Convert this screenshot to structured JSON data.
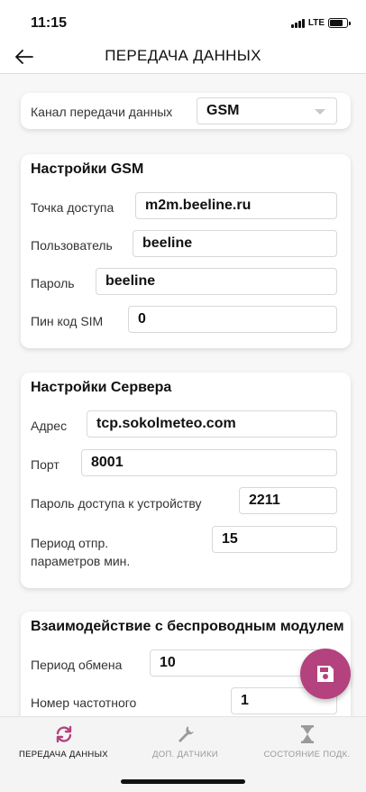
{
  "status_bar": {
    "time": "11:15",
    "network": "LTE"
  },
  "header": {
    "title": "ПЕРЕДАЧА ДАННЫХ"
  },
  "channel": {
    "label": "Канал передачи данных",
    "value": "GSM"
  },
  "gsm": {
    "title": "Настройки GSM",
    "apn_label": "Точка доступа",
    "apn_value": "m2m.beeline.ru",
    "user_label": "Пользователь",
    "user_value": "beeline",
    "password_label": "Пароль",
    "password_value": "beeline",
    "pin_label": "Пин код SIM",
    "pin_value": "0"
  },
  "server": {
    "title": "Настройки Сервера",
    "address_label": "Адрес",
    "address_value": "tcp.sokolmeteo.com",
    "port_label": "Порт",
    "port_value": "8001",
    "device_password_label": "Пароль доступа к устройству",
    "device_password_value": "2211",
    "period_label_line1": "Период отпр.",
    "period_label_line2": "параметров мин.",
    "period_value": "15"
  },
  "wireless": {
    "title": "Взаимодействие с беспроводным модулем",
    "exchange_period_label": "Период обмена",
    "exchange_period_value": "10",
    "frequency_label": "Номер частотного",
    "frequency_value": "1"
  },
  "tabs": [
    {
      "label": "ПЕРЕДАЧА ДАННЫХ",
      "icon": "sync-icon",
      "active": true
    },
    {
      "label": "ДОП. ДАТЧИКИ",
      "icon": "wrench-icon",
      "active": false
    },
    {
      "label": "СОСТОЯНИЕ ПОДК.",
      "icon": "hourglass-icon",
      "active": false
    }
  ],
  "colors": {
    "accent": "#b3427e",
    "inactive": "#9a9a9a"
  }
}
